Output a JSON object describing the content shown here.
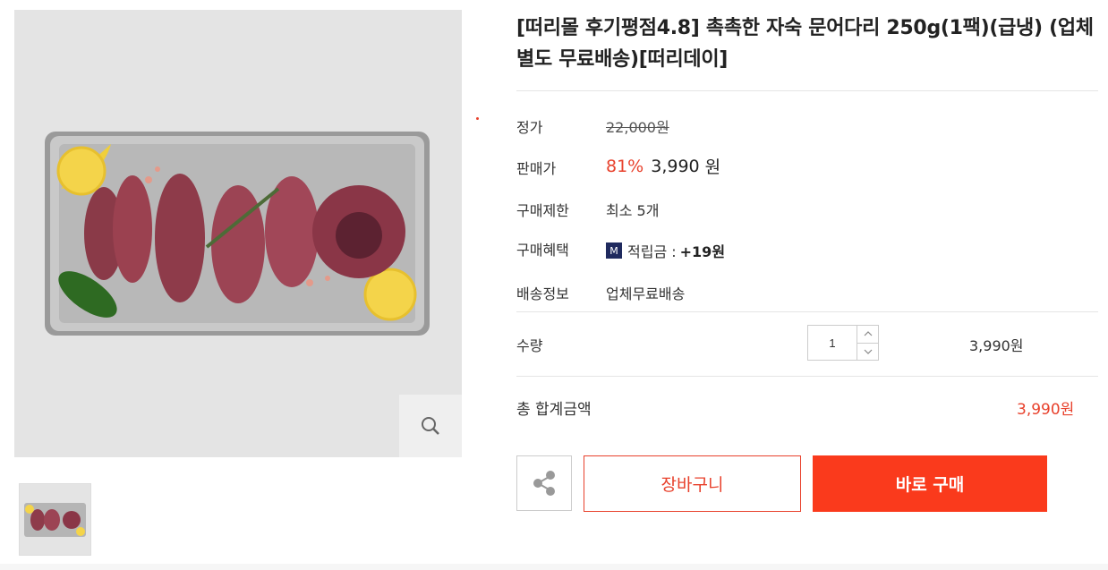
{
  "product": {
    "title": "[떠리몰 후기평점4.8] 촉촉한 자숙 문어다리 250g(1팩)(급냉) (업체별도 무료배송)[떠리데이]"
  },
  "info": {
    "list_price": {
      "label": "정가",
      "value": "22,000원"
    },
    "sale": {
      "label": "판매가",
      "discount": "81%",
      "price": "3,990",
      "unit": "원"
    },
    "limit": {
      "label": "구매제한",
      "value": "최소 5개"
    },
    "benefit": {
      "label": "구매혜택",
      "badge": "M",
      "text": "적립금 :",
      "amount": "+19원"
    },
    "shipping": {
      "label": "배송정보",
      "value": "업체무료배송"
    }
  },
  "quantity": {
    "label": "수량",
    "value": "1",
    "line_price": "3,990원"
  },
  "total": {
    "label": "총 합계금액",
    "value": "3,990원"
  },
  "buttons": {
    "cart": "장바구니",
    "buy": "바로 구매"
  },
  "colors": {
    "accent": "#e8412c",
    "buy_button": "#fa3a1c",
    "badge": "#1f2a5e"
  },
  "icons": {
    "zoom": "magnifier-icon",
    "share": "share-icon",
    "up": "chevron-up-icon",
    "down": "chevron-down-icon"
  }
}
